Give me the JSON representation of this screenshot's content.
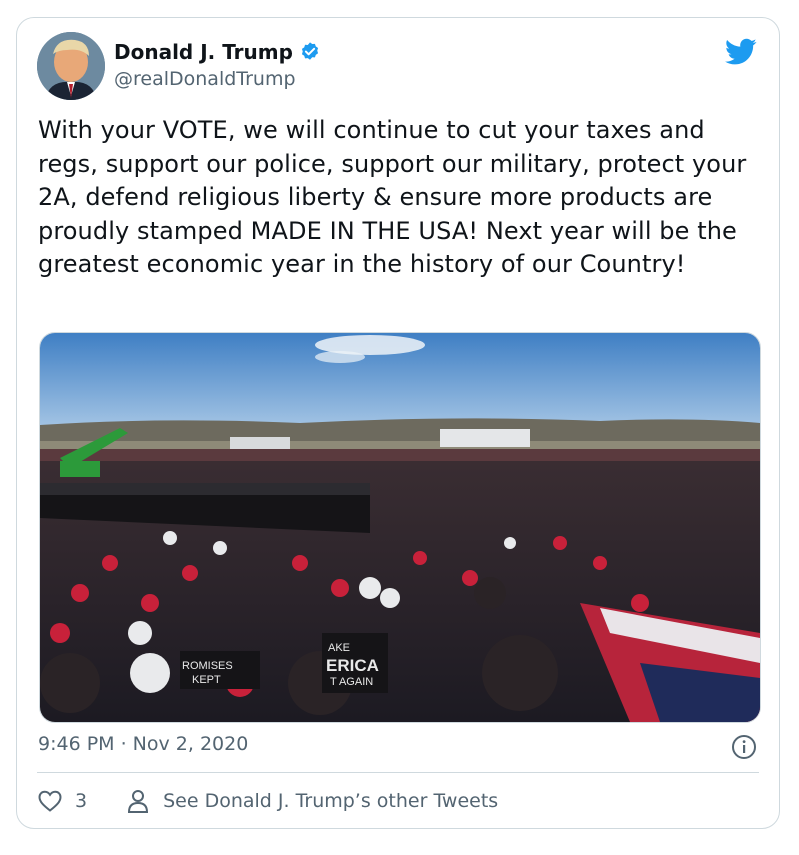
{
  "author": {
    "display_name": "Donald J. Trump",
    "handle": "@realDonaldTrump",
    "verified_icon": "verified-badge-icon",
    "avatar_icon": "avatar"
  },
  "tweet": {
    "text": "With your VOTE, we will continue to cut your taxes and regs, support our police, support our military, protect your 2A, defend religious liberty & ensure more products are proudly stamped MADE IN THE USA! Next year will be the greatest economic year in the history of our Country!",
    "timestamp": "9:46 PM · Nov 2, 2020"
  },
  "media": {
    "description_icon": "rally-crowd-photo",
    "sign_texts": [
      "ROMISES",
      "KEPT",
      "AKE",
      "ERICA",
      "T AGAIN"
    ]
  },
  "actions": {
    "like_count": "3",
    "other_tweets_label": "See Donald J. Trump’s other Tweets"
  },
  "colors": {
    "brand_blue": "#1d9bf0",
    "text_secondary": "#536471",
    "border": "#cfd9de"
  }
}
